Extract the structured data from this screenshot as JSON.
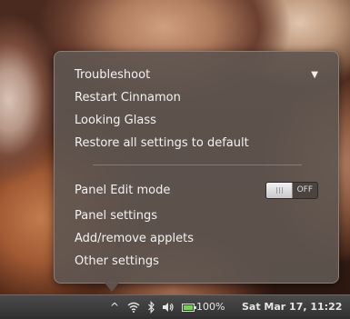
{
  "menu": {
    "items": [
      {
        "label": "Troubleshoot",
        "has_submenu": true
      },
      {
        "label": "Restart Cinnamon"
      },
      {
        "label": "Looking Glass"
      },
      {
        "label": "Restore all settings to default"
      },
      {
        "label": "Panel Edit mode",
        "toggle": {
          "state_label": "OFF",
          "on": false
        }
      },
      {
        "label": "Panel settings"
      },
      {
        "label": "Add/remove applets"
      },
      {
        "label": "Other settings"
      }
    ],
    "submenu_arrow": "▼"
  },
  "panel": {
    "tray_up_icon": "^",
    "wifi_icon": "wifi-icon",
    "bluetooth_icon": "bluetooth-icon",
    "volume_icon": "volume-icon",
    "battery_percent": "100%",
    "clock": "Sat Mar 17, 11:22"
  }
}
